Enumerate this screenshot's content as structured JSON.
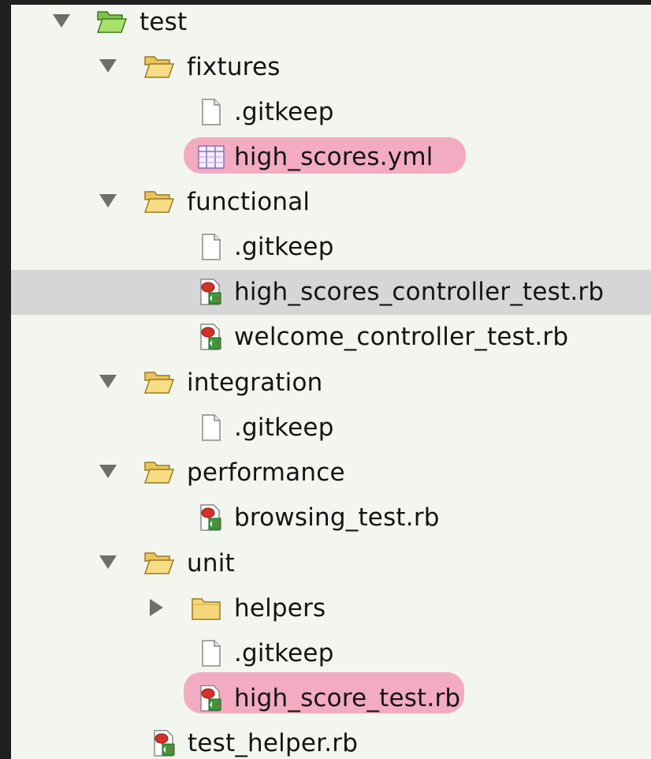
{
  "tree": {
    "root": {
      "label": "test",
      "expanded": true
    },
    "fixtures": {
      "label": "fixtures",
      "expanded": true
    },
    "fixtures_gitkeep": {
      "label": ".gitkeep"
    },
    "fixtures_high_scores_yml": {
      "label": "high_scores.yml"
    },
    "functional": {
      "label": "functional",
      "expanded": true
    },
    "functional_gitkeep": {
      "label": ".gitkeep"
    },
    "functional_high_scores_controller_test": {
      "label": "high_scores_controller_test.rb"
    },
    "functional_welcome_controller_test": {
      "label": "welcome_controller_test.rb"
    },
    "integration": {
      "label": "integration",
      "expanded": true
    },
    "integration_gitkeep": {
      "label": ".gitkeep"
    },
    "performance": {
      "label": "performance",
      "expanded": true
    },
    "performance_browsing_test": {
      "label": "browsing_test.rb"
    },
    "unit": {
      "label": "unit",
      "expanded": true
    },
    "unit_helpers": {
      "label": "helpers",
      "expanded": false
    },
    "unit_gitkeep": {
      "label": ".gitkeep"
    },
    "unit_high_score_test": {
      "label": "high_score_test.rb"
    },
    "test_helper": {
      "label": "test_helper.rb"
    }
  },
  "colors": {
    "panel_background": "#f2f6ef",
    "selection": "#d6d6d6",
    "highlight": "#f2a6bf",
    "folder": "#f5d77a",
    "folder_open_root": "#9fdc6a"
  },
  "icons": {
    "folder": "folder-icon",
    "folder_open": "folder-open-icon",
    "file": "file-icon",
    "yaml": "yaml-table-icon",
    "ruby": "ruby-file-icon",
    "disclosure_open": "triangle-down-icon",
    "disclosure_closed": "triangle-right-icon"
  }
}
